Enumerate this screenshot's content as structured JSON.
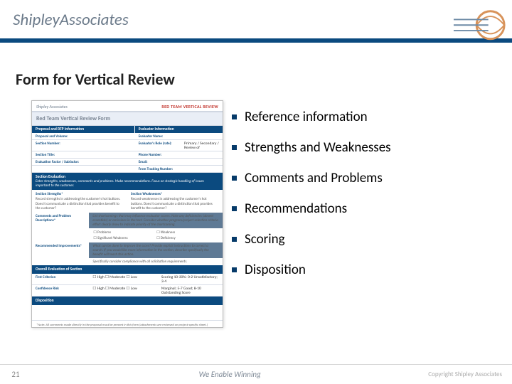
{
  "header": {
    "brand_a": "Shipley",
    "brand_b": "Associates"
  },
  "slide": {
    "title": "Form for Vertical Review",
    "page_number": "21",
    "footer_mid": "We Enable Winning",
    "footer_copy": "Copyright Shipley Associates"
  },
  "bullets": [
    "Reference information",
    "Strengths and Weaknesses",
    "Comments and Problems",
    "Recommendations",
    "Scoring",
    "Disposition"
  ],
  "form": {
    "logo": "Shipley Associates",
    "tag": "RED TEAM VERTICAL REVIEW",
    "title": "Red Team Vertical Review Form",
    "bar1_left": "Proposal and RFP Information",
    "bar1_right": "Evaluator Information",
    "rows": [
      {
        "l": "Proposal and Volume:",
        "v": "",
        "l2": "Evaluator Name:",
        "v2": ""
      },
      {
        "l": "Section Number:",
        "v": "",
        "l2": "Evaluator's Role (rate):",
        "v2": "Primary / Secondary / Review of"
      },
      {
        "l": "Section Title:",
        "v": "",
        "l2": "Phone Number:",
        "v2": ""
      },
      {
        "l": "Evaluation Factor / Subfactor:",
        "v": "",
        "l2": "Email:",
        "v2": ""
      },
      {
        "l": "",
        "v": "",
        "l2": "From Tracking Number:",
        "v2": ""
      }
    ],
    "sec_eval_title": "Section Evaluation",
    "sec_eval_sub": "Enter strengths, weaknesses, comments and problems. Make recommendations. Focus on strategic handling of issues important to the customer.",
    "strength_h": "Section Strengths*",
    "strength_t": "Record strengths in addressing the customer's hot buttons. Does it communicate a distinction that provides benefit to the customer?",
    "weak_h": "Section Weaknesses*",
    "weak_t": "Record weaknesses in addressing the customer's hot buttons. Does it communicate a distinction that provides benefit to the customer?",
    "cp_label": "Comments and Problem Descriptions*",
    "cp_band": "List shortcomings that may influence evaluator scores. Note any deficiencies (absent essentials) or omissions in the text. Consider whether program/project selection criteria effort clearly show to indicate priority of the shortcoming.",
    "checks": [
      "Problems",
      "Weakness",
      "Significant Weakness",
      "Deficiency"
    ],
    "rec_label": "Recommended Improvements*",
    "rec_band": "What can be done to improve the score? Provide explicit instructions to correct a search. If you would like more information in the section, describe specifically the benefit will teach this action.",
    "rec_sub": "Specifically consider compliance with all solicitation requirements.",
    "overall_title": "Overall Evaluation of Section",
    "overall_rows": [
      {
        "l": "First Criterion",
        "v": "☐ High   ☐ Moderate   ☐ Low",
        "r": "Scoring 10-30%: 0-2 Unsatisfactory; 3-4"
      },
      {
        "l": "Confidence Risk",
        "v": "☐ High   ☐ Moderate   ☐ Low",
        "r": "Marginal; 5-7 Good; 8-10 Outstanding    Score"
      }
    ],
    "disp_title": "Disposition",
    "foot": "*Note: All comments made directly in the proposal must be present in this form (attachments are reviewed on project-specific sheet.)"
  }
}
